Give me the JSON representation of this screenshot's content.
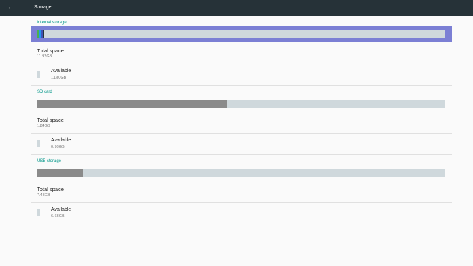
{
  "appbar": {
    "title": "Storage",
    "back_icon": "arrow-left-icon",
    "overflow_icon": "more-vert-icon"
  },
  "colors": {
    "accent": "#009688",
    "appbar": "#263238",
    "bar_track": "#cfd8dc",
    "used": "#8a8a8a",
    "selected": "#7b7fd4"
  },
  "sections": [
    {
      "header": "Internal storage",
      "selected": true,
      "usage": [
        {
          "color": "#4caf50",
          "fraction": 0.006
        },
        {
          "color": "#2196f3",
          "fraction": 0.004
        },
        {
          "color": "#3f51b5",
          "fraction": 0.004
        },
        {
          "color": "#263238",
          "fraction": 0.004
        }
      ],
      "total_label": "Total space",
      "total_value": "11.92GB",
      "available_label": "Available",
      "available_value": "11.80GB"
    },
    {
      "header": "SD card",
      "selected": false,
      "usage": [
        {
          "color": "#8a8a8a",
          "fraction": 0.465
        }
      ],
      "total_label": "Total space",
      "total_value": "1.84GB",
      "available_label": "Available",
      "available_value": "0.98GB"
    },
    {
      "header": "USB storage",
      "selected": false,
      "usage": [
        {
          "color": "#8a8a8a",
          "fraction": 0.113
        }
      ],
      "total_label": "Total space",
      "total_value": "7.48GB",
      "available_label": "Available",
      "available_value": "6.63GB"
    }
  ]
}
